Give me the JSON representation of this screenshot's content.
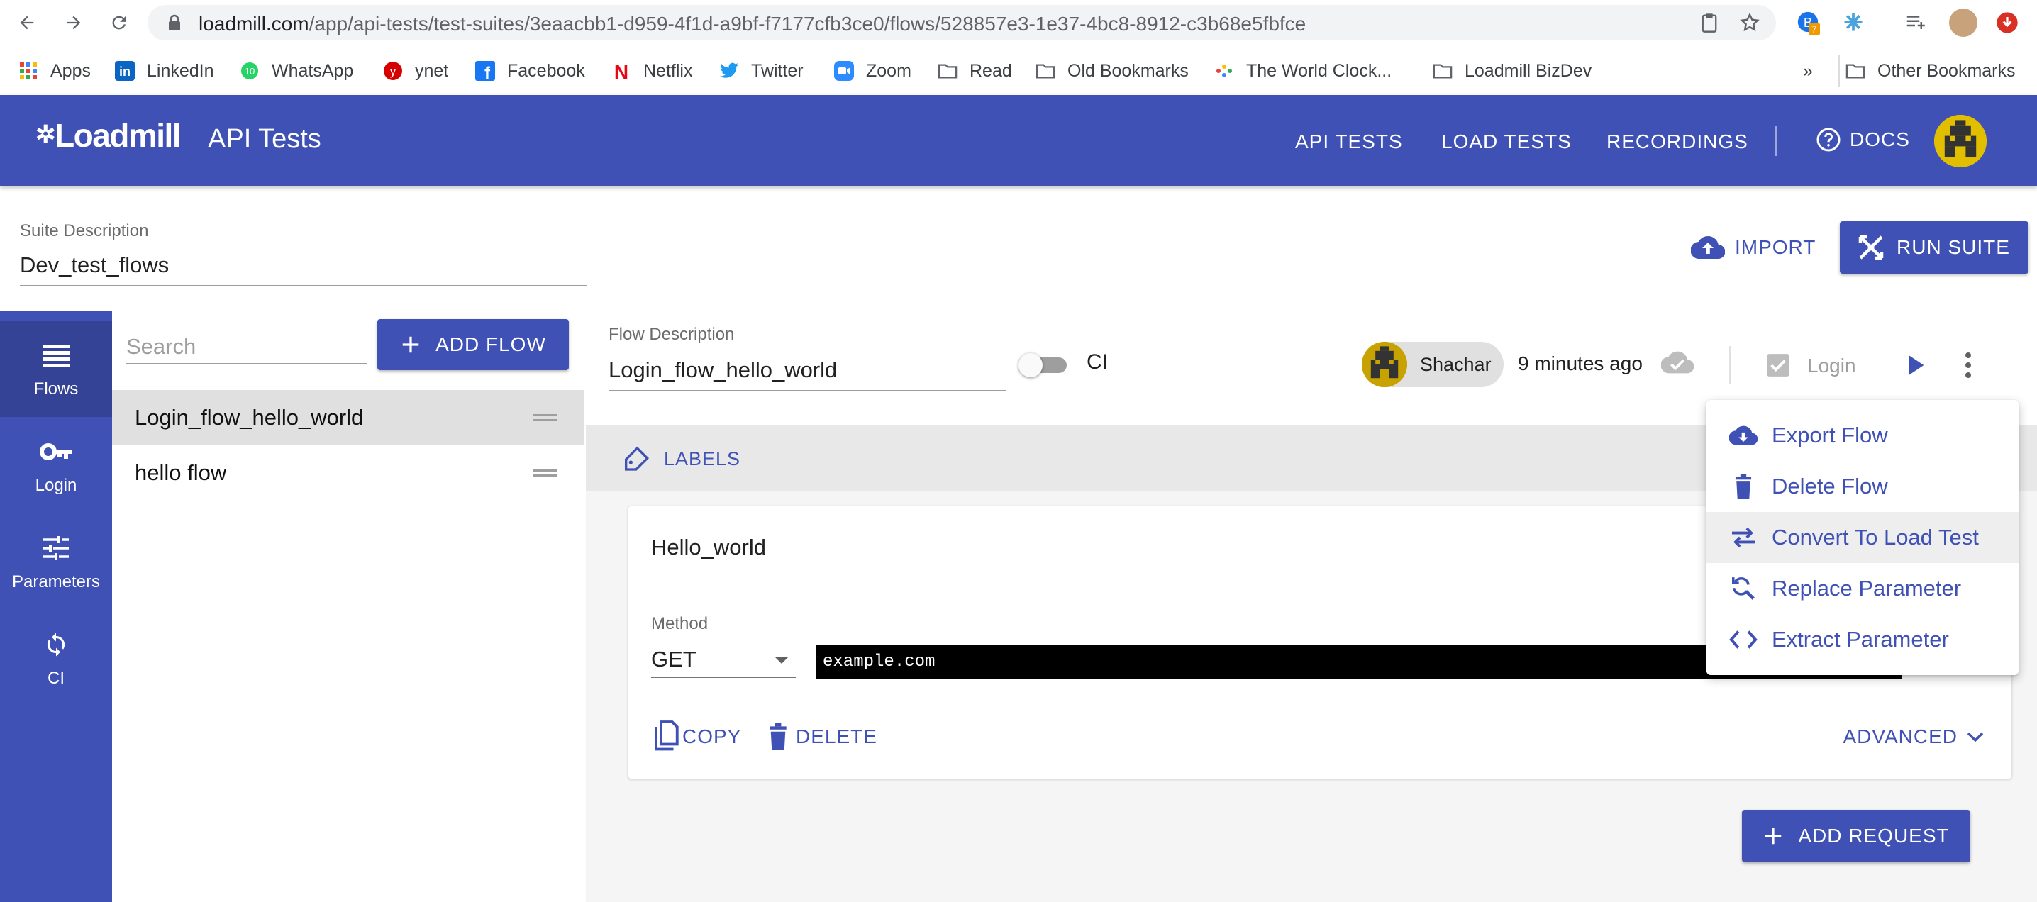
{
  "browser": {
    "url_host": "loadmill.com",
    "url_path": "/app/api-tests/test-suites/3eaacbb1-d959-4f1d-a9bf-f7177cfb3ce0/flows/528857e3-1e37-4bc8-8912-c3b68e5fbfce",
    "extension_badge": "7",
    "bookmarks": [
      {
        "label": "Apps",
        "icon": "apps-grid-icon"
      },
      {
        "label": "LinkedIn",
        "icon": "linkedin-icon"
      },
      {
        "label": "WhatsApp",
        "icon": "whatsapp-icon"
      },
      {
        "label": "ynet",
        "icon": "ynet-icon"
      },
      {
        "label": "Facebook",
        "icon": "facebook-icon"
      },
      {
        "label": "Netflix",
        "icon": "netflix-icon"
      },
      {
        "label": "Twitter",
        "icon": "twitter-icon"
      },
      {
        "label": "Zoom",
        "icon": "zoom-icon"
      },
      {
        "label": "Read",
        "icon": "folder-icon"
      },
      {
        "label": "Old Bookmarks",
        "icon": "folder-icon"
      },
      {
        "label": "The World Clock...",
        "icon": "worldclock-icon"
      },
      {
        "label": "Loadmill BizDev",
        "icon": "folder-icon"
      }
    ],
    "more_bookmarks": "»",
    "other_bookmarks": "Other Bookmarks"
  },
  "app": {
    "logo": "Loadmill",
    "title": "API Tests",
    "nav": [
      "API TESTS",
      "LOAD TESTS",
      "RECORDINGS"
    ],
    "docs": "DOCS"
  },
  "suite": {
    "description_label": "Suite Description",
    "description": "Dev_test_flows",
    "import_label": "IMPORT",
    "run_label": "RUN SUITE"
  },
  "rail": [
    {
      "label": "Flows",
      "icon": "flows-menu-icon",
      "active": true
    },
    {
      "label": "Login",
      "icon": "key-icon",
      "active": false
    },
    {
      "label": "Parameters",
      "icon": "sliders-icon",
      "active": false
    },
    {
      "label": "CI",
      "icon": "sync-icon",
      "active": false
    }
  ],
  "flows": {
    "search_placeholder": "Search",
    "add_flow_label": "ADD FLOW",
    "items": [
      {
        "name": "Login_flow_hello_world",
        "selected": true
      },
      {
        "name": "hello flow",
        "selected": false
      }
    ]
  },
  "flow": {
    "description_label": "Flow Description",
    "description": "Login_flow_hello_world",
    "ci_label": "CI",
    "ci_enabled": false,
    "user": "Shachar",
    "time_ago": "9 minutes ago",
    "login_label": "Login",
    "labels_label": "LABELS"
  },
  "request": {
    "name": "Hello_world",
    "method_label": "Method",
    "method": "GET",
    "url": "example.com",
    "copy_label": "COPY",
    "delete_label": "DELETE",
    "advanced_label": "ADVANCED"
  },
  "add_request_label": "ADD REQUEST",
  "menu": {
    "items": [
      {
        "label": "Export Flow",
        "icon": "cloud-download-icon"
      },
      {
        "label": "Delete Flow",
        "icon": "trash-icon"
      },
      {
        "label": "Convert To Load Test",
        "icon": "swap-arrows-icon",
        "hovered": true
      },
      {
        "label": "Replace Parameter",
        "icon": "find-replace-icon"
      },
      {
        "label": "Extract Parameter",
        "icon": "code-brackets-icon"
      }
    ]
  },
  "colors": {
    "primary": "#3f51b5",
    "rail_active": "#344395",
    "url_field_bg": "#000000"
  }
}
